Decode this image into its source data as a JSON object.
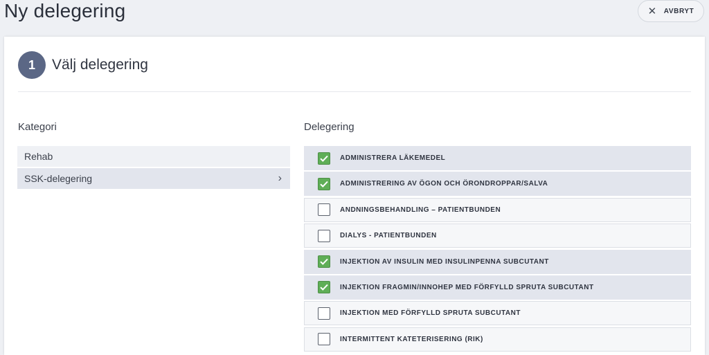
{
  "header": {
    "title": "Ny delegering",
    "cancel_label": "AVBRYT"
  },
  "step": {
    "number": "1",
    "title": "Välj delegering"
  },
  "category": {
    "heading": "Kategori",
    "items": [
      {
        "label": "Rehab",
        "selected": false
      },
      {
        "label": "SSK-delegering",
        "selected": true
      }
    ]
  },
  "delegation": {
    "heading": "Delegering",
    "items": [
      {
        "label": "ADMINISTRERA LÄKEMEDEL",
        "checked": true
      },
      {
        "label": "ADMINISTRERING AV ÖGON OCH ÖRONDROPPAR/SALVA",
        "checked": true
      },
      {
        "label": "ANDNINGSBEHANDLING – PATIENTBUNDEN",
        "checked": false
      },
      {
        "label": "DIALYS - PATIENTBUNDEN",
        "checked": false
      },
      {
        "label": "INJEKTION AV INSULIN MED INSULINPENNA SUBCUTANT",
        "checked": true
      },
      {
        "label": "INJEKTION FRAGMIN/INNOHEP MED FÖRFYLLD SPRUTA SUBCUTANT",
        "checked": true
      },
      {
        "label": "INJEKTION MED FÖRFYLLD SPRUTA SUBCUTANT",
        "checked": false
      },
      {
        "label": "INTERMITTENT KATETERISERING (RIK)",
        "checked": false
      }
    ]
  },
  "colors": {
    "step_circle": "#5b6785",
    "checked_green": "#5fae57",
    "selected_row": "#e2e5ed"
  }
}
